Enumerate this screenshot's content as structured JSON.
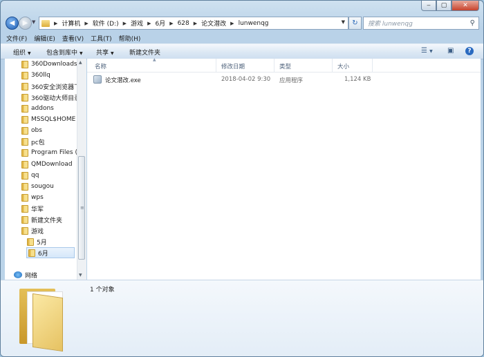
{
  "window": {
    "caption_buttons": {
      "minimize": "‒",
      "maximize": "▢",
      "close": "✕"
    }
  },
  "address_bar": {
    "crumbs": [
      "计算机",
      "软件 (D:)",
      "游戏",
      "6月",
      "628",
      "论文潜改",
      "lunwenqg"
    ],
    "search_placeholder": "搜索 lunwenqg"
  },
  "menu": [
    "文件(F)",
    "编辑(E)",
    "查看(V)",
    "工具(T)",
    "帮助(H)"
  ],
  "toolbar": {
    "organize": "组织",
    "include_in_library": "包含到库中",
    "share": "共享",
    "new_folder": "新建文件夹"
  },
  "nav_tree": {
    "items": [
      "360Downloads",
      "360llq",
      "360安全浏览器下",
      "360驱动大师目录",
      "addons",
      "MSSQL$HOME",
      "obs",
      "pc包",
      "Program Files (",
      "QMDownload",
      "qq",
      "sougou",
      "wps",
      "华军",
      "新建文件夹",
      "游戏",
      "5月",
      "6月"
    ],
    "selected": "6月",
    "network": "网络"
  },
  "columns": {
    "name": "名称",
    "modified": "修改日期",
    "type": "类型",
    "size": "大小"
  },
  "files": [
    {
      "name": "论文潜改.exe",
      "modified": "2018-04-02 9:30",
      "type": "应用程序",
      "size": "1,124 KB"
    }
  ],
  "details": {
    "summary": "1 个对象"
  },
  "colors": {
    "accent": "#2868b8",
    "selection": "#d5e7fa",
    "folder": "#f6df8c"
  },
  "icons": [
    "back-icon",
    "forward-icon",
    "refresh-icon",
    "search-icon",
    "folder-icon",
    "network-icon",
    "exe-icon",
    "view-options-icon",
    "preview-pane-icon",
    "help-icon"
  ]
}
